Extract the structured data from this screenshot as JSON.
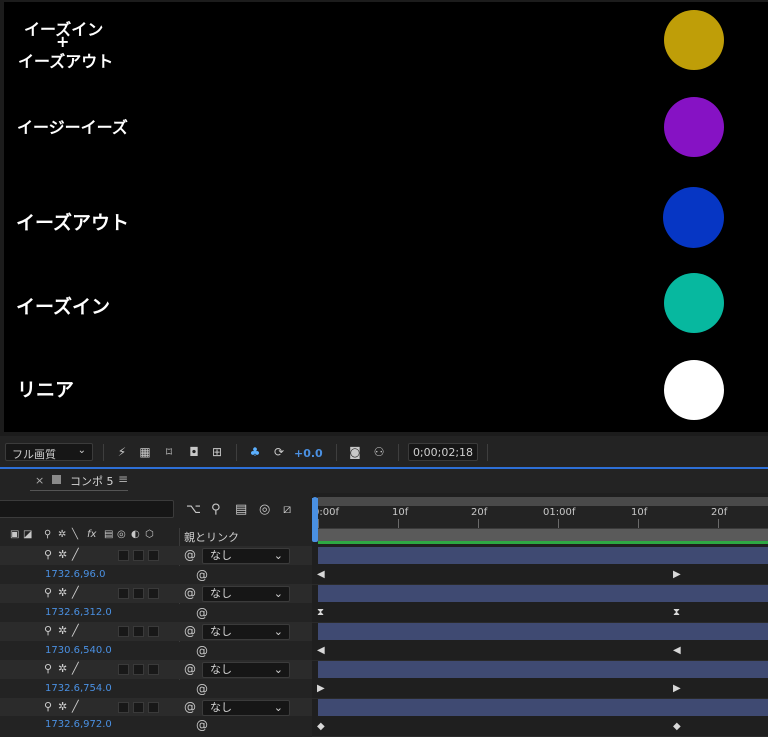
{
  "canvas": {
    "labels": [
      {
        "text": "イーズイン",
        "color": "#ffffff"
      },
      {
        "text": "+",
        "color": "#ffffff"
      },
      {
        "text": "イーズアウト",
        "color": "#ffffff"
      },
      {
        "text": "イージーイーズ",
        "color": "#ffffff"
      },
      {
        "text": "イーズアウト",
        "color": "#ffffff"
      },
      {
        "text": "イーズイン",
        "color": "#ffffff"
      },
      {
        "text": "リニア",
        "color": "#ffffff"
      }
    ],
    "circles": [
      {
        "name": "gold",
        "color": "#bf9e08"
      },
      {
        "name": "purple",
        "color": "#8612c4"
      },
      {
        "name": "blue",
        "color": "#0636c4"
      },
      {
        "name": "teal",
        "color": "#07b89f"
      },
      {
        "name": "white",
        "color": "#ffffff"
      }
    ]
  },
  "viewer_toolbar": {
    "resolution": "フル画質",
    "exposure": "+0.0",
    "timecode": "0;00;02;18",
    "icons": [
      "fast-preview-icon",
      "transparency-grid-icon",
      "mask-path-icon",
      "region-of-interest-icon",
      "grid-guides-icon",
      "color-channels-icon",
      "reset-exposure-icon",
      "snapshot-icon",
      "show-snapshot-icon"
    ]
  },
  "timeline": {
    "tab_close": "×",
    "tab_title": "コンポ 5",
    "tab_menu": "≡",
    "parent_header": "親とリンク",
    "ruler_labels": [
      "0:00f",
      "10f",
      "20f",
      "01:00f",
      "10f",
      "20f"
    ],
    "layers": [
      {
        "parent": "なし",
        "position": "1732.6,96.0",
        "key_in": "◀",
        "key_out": "▶"
      },
      {
        "parent": "なし",
        "position": "1732.6,312.0",
        "key_in": "⧗",
        "key_out": "⧗"
      },
      {
        "parent": "なし",
        "position": "1730.6,540.0",
        "key_in": "◀",
        "key_out": "◀"
      },
      {
        "parent": "なし",
        "position": "1732.6,754.0",
        "key_in": "▶",
        "key_out": "▶"
      },
      {
        "parent": "なし",
        "position": "1732.6,972.0",
        "key_in": "◆",
        "key_out": "◆"
      }
    ]
  },
  "colors": {
    "accent": "#4a90e2",
    "layer_bar": "#3f4a72",
    "workarea_green": "#2ea843"
  }
}
